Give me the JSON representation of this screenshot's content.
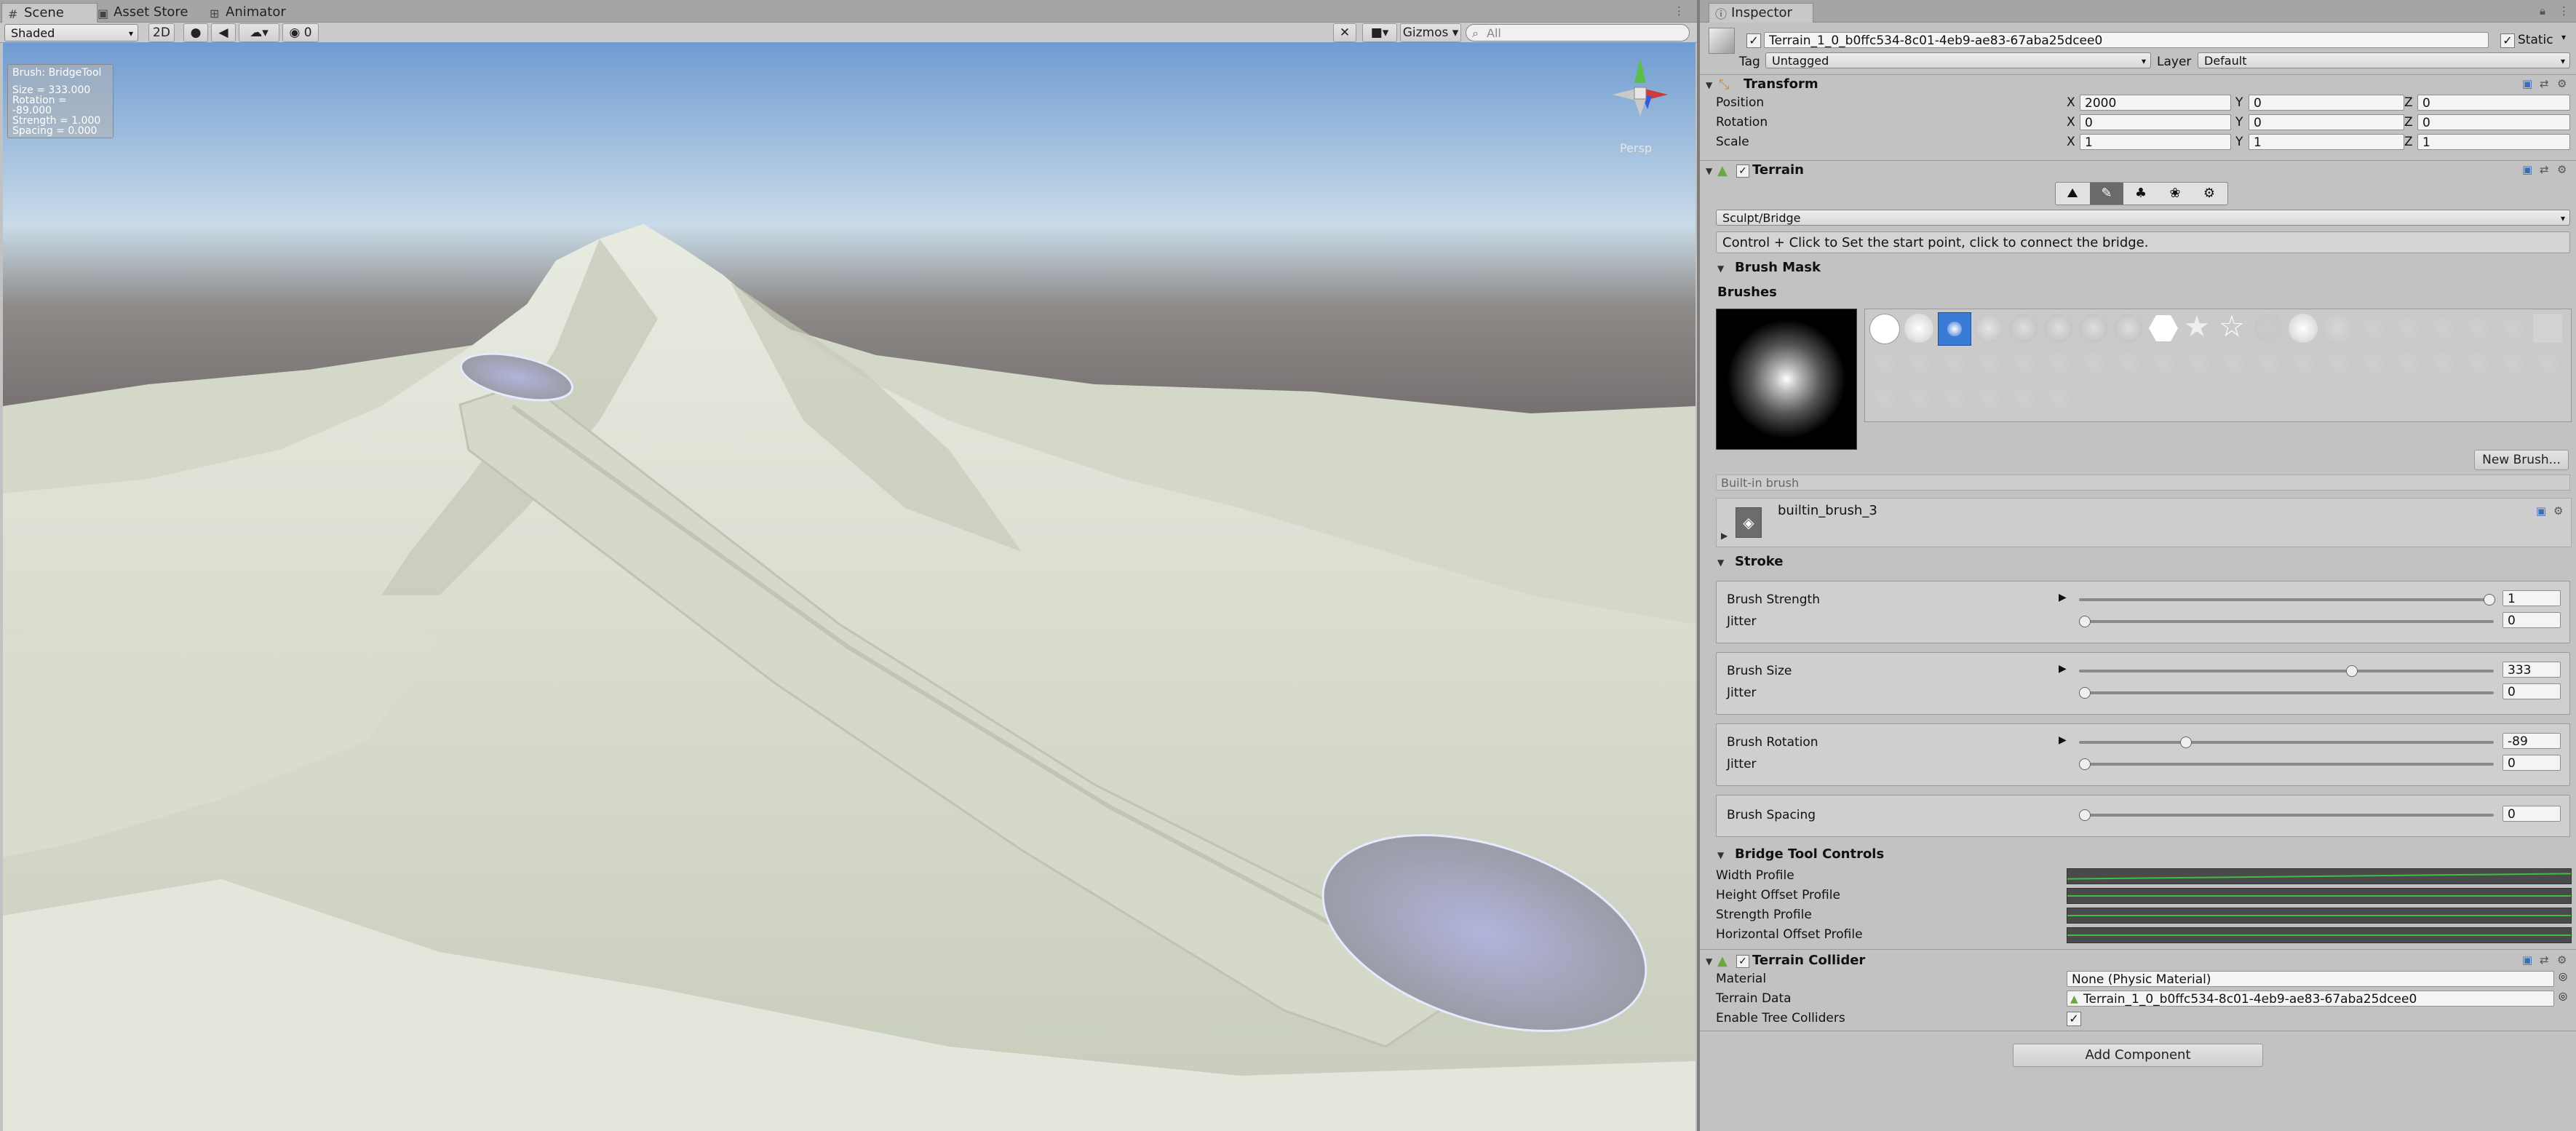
{
  "scene_tabs": {
    "scene": "Scene",
    "asset_store": "Asset Store",
    "animator": "Animator"
  },
  "scene_toolbar": {
    "shading_mode": "Shaded",
    "mode_2d": "2D",
    "hidden_count": "0",
    "gizmos": "Gizmos",
    "search_placeholder": "All"
  },
  "scene_overlay": {
    "brush_title": "Brush: BridgeTool",
    "size": "Size = 333.000",
    "rotation": "Rotation = -89.000",
    "strength": "Strength = 1.000",
    "spacing": "Spacing = 0.000",
    "persp_label": "Persp"
  },
  "inspector": {
    "tab": "Inspector",
    "object_name": "Terrain_1_0_b0ffc534-8c01-4eb9-ae83-67aba25dcee0",
    "static_label": "Static",
    "tag_label": "Tag",
    "tag_value": "Untagged",
    "layer_label": "Layer",
    "layer_value": "Default"
  },
  "transform": {
    "title": "Transform",
    "rows": [
      {
        "label": "Position",
        "x": "2000",
        "y": "0",
        "z": "0"
      },
      {
        "label": "Rotation",
        "x": "0",
        "y": "0",
        "z": "0"
      },
      {
        "label": "Scale",
        "x": "1",
        "y": "1",
        "z": "1"
      }
    ],
    "axis_x": "X",
    "axis_y": "Y",
    "axis_z": "Z"
  },
  "terrain": {
    "title": "Terrain",
    "tool_dropdown": "Sculpt/Bridge",
    "help_text": "Control + Click to Set the start point, click to connect the bridge.",
    "brush_mask": "Brush Mask",
    "brushes": "Brushes",
    "new_brush": "New Brush...",
    "builtin_brush_label": "Built-in brush",
    "brush_asset": "builtin_brush_3",
    "stroke": "Stroke"
  },
  "stroke_groups": [
    {
      "label": "Brush Strength",
      "value": "1",
      "fraction": 1.0,
      "jitter_label": "Jitter",
      "jitter": "0"
    },
    {
      "label": "Brush Size",
      "value": "333",
      "fraction": 0.66,
      "jitter_label": "Jitter",
      "jitter": "0"
    },
    {
      "label": "Brush Rotation",
      "value": "-89",
      "fraction": 0.25,
      "jitter_label": "Jitter",
      "jitter": "0"
    }
  ],
  "brush_spacing": {
    "label": "Brush Spacing",
    "value": "0",
    "fraction": 0.0
  },
  "bridge_controls": {
    "title": "Bridge Tool Controls",
    "width_profile": "Width Profile",
    "height_offset_profile": "Height Offset Profile",
    "strength_profile": "Strength Profile",
    "horizontal_offset_profile": "Horizontal Offset Profile"
  },
  "terrain_collider": {
    "title": "Terrain Collider",
    "material_label": "Material",
    "material_value": "None (Physic Material)",
    "terrain_data_label": "Terrain Data",
    "terrain_data_value": "Terrain_1_0_b0ffc534-8c01-4eb9-ae83-67aba25dcee0",
    "tree_colliders_label": "Enable Tree Colliders"
  },
  "add_component": "Add Component",
  "colors": {
    "panel_bg": "#c2c2c2",
    "selected_brush": "#3a7bd5",
    "curve_green": "#3fbf3f",
    "terrain": "#dfe3d6",
    "sky_top": "#7fa6d6"
  }
}
